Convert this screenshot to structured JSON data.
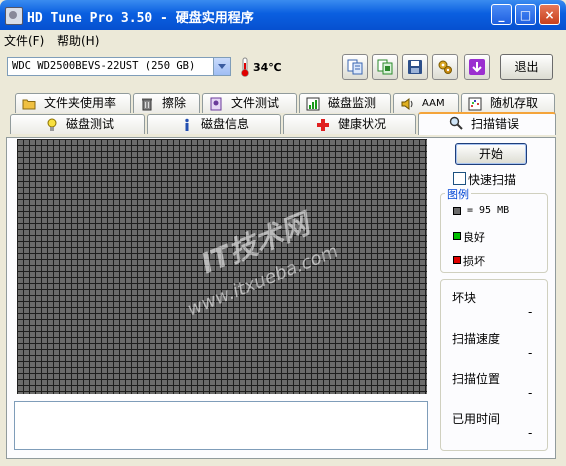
{
  "window": {
    "title": "HD Tune Pro 3.50 - 硬盘实用程序",
    "controls": {
      "minimize": "_",
      "maximize": "□",
      "close": "×"
    }
  },
  "menu": [
    {
      "label": "文件(F)"
    },
    {
      "label": "帮助(H)"
    }
  ],
  "toolbar": {
    "drive": "WDC WD2500BEVS-22UST (250 GB)",
    "temperature": "34℃",
    "exit_label": "退出",
    "tool_icons": [
      "copy-icon",
      "copy-screenshot-icon",
      "save-icon",
      "options-icon",
      "download-icon"
    ]
  },
  "tabs_row1": [
    {
      "label": "文件夹使用率",
      "icon": "folder-icon"
    },
    {
      "label": "擦除",
      "icon": "trash-icon"
    },
    {
      "label": "文件测试",
      "icon": "file-test-icon"
    },
    {
      "label": "磁盘监测",
      "icon": "monitor-icon"
    },
    {
      "label": "AAM",
      "icon": "speaker-icon"
    },
    {
      "label": "随机存取",
      "icon": "random-access-icon"
    }
  ],
  "tabs_row2": [
    {
      "label": "磁盘测试",
      "icon": "bulb-icon"
    },
    {
      "label": "磁盘信息",
      "icon": "info-icon"
    },
    {
      "label": "健康状况",
      "icon": "health-cross-icon"
    },
    {
      "label": "扫描错误",
      "icon": "magnifier-icon",
      "active": true
    }
  ],
  "scan": {
    "start_label": "开始",
    "quick_scan_label": "快速扫描",
    "quick_scan_checked": false
  },
  "legend": {
    "title": "图例",
    "block": "= 95 MB",
    "good": "良好",
    "bad": "损坏",
    "colors": {
      "block": "#6b6b6b",
      "good": "#00c000",
      "bad": "#e00000"
    }
  },
  "stats": [
    {
      "label": "坏块",
      "value": "-"
    },
    {
      "label": "扫描速度",
      "value": "-"
    },
    {
      "label": "扫描位置",
      "value": "-"
    },
    {
      "label": "已用时间",
      "value": "-"
    }
  ],
  "watermark": {
    "line1": "IT技术网",
    "line2": "www.itxueba.com"
  }
}
